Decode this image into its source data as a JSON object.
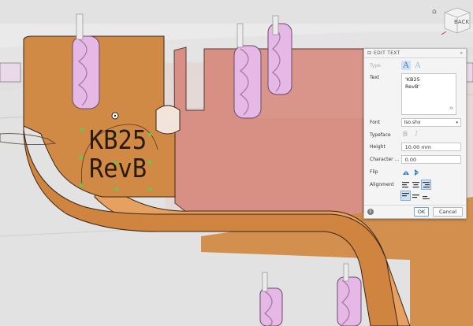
{
  "viewcube": {
    "back_label": "BACK"
  },
  "model": {
    "text_line1": "KB25",
    "text_line2": "RevB"
  },
  "dialog": {
    "title": "EDIT TEXT",
    "type_label": "Type",
    "text_label": "Text",
    "text_value_line1": "'KB25",
    "text_value_line2": "RevB'",
    "fx_label": "fx",
    "font_label": "Font",
    "font_value": "Iso.shx",
    "typeface_label": "Typeface",
    "height_label": "Height",
    "height_value": "10.00 mm",
    "character_label": "Character ...",
    "character_value": "0.00",
    "flip_label": "Flip",
    "alignment_label": "Alignment",
    "ok_label": "OK",
    "cancel_label": "Cancel"
  },
  "colors": {
    "part_orange": "#d18a45",
    "pink_body": "#d88f84",
    "accent_blue": "#2f7cc0",
    "sketch_green": "#4bd64b"
  }
}
